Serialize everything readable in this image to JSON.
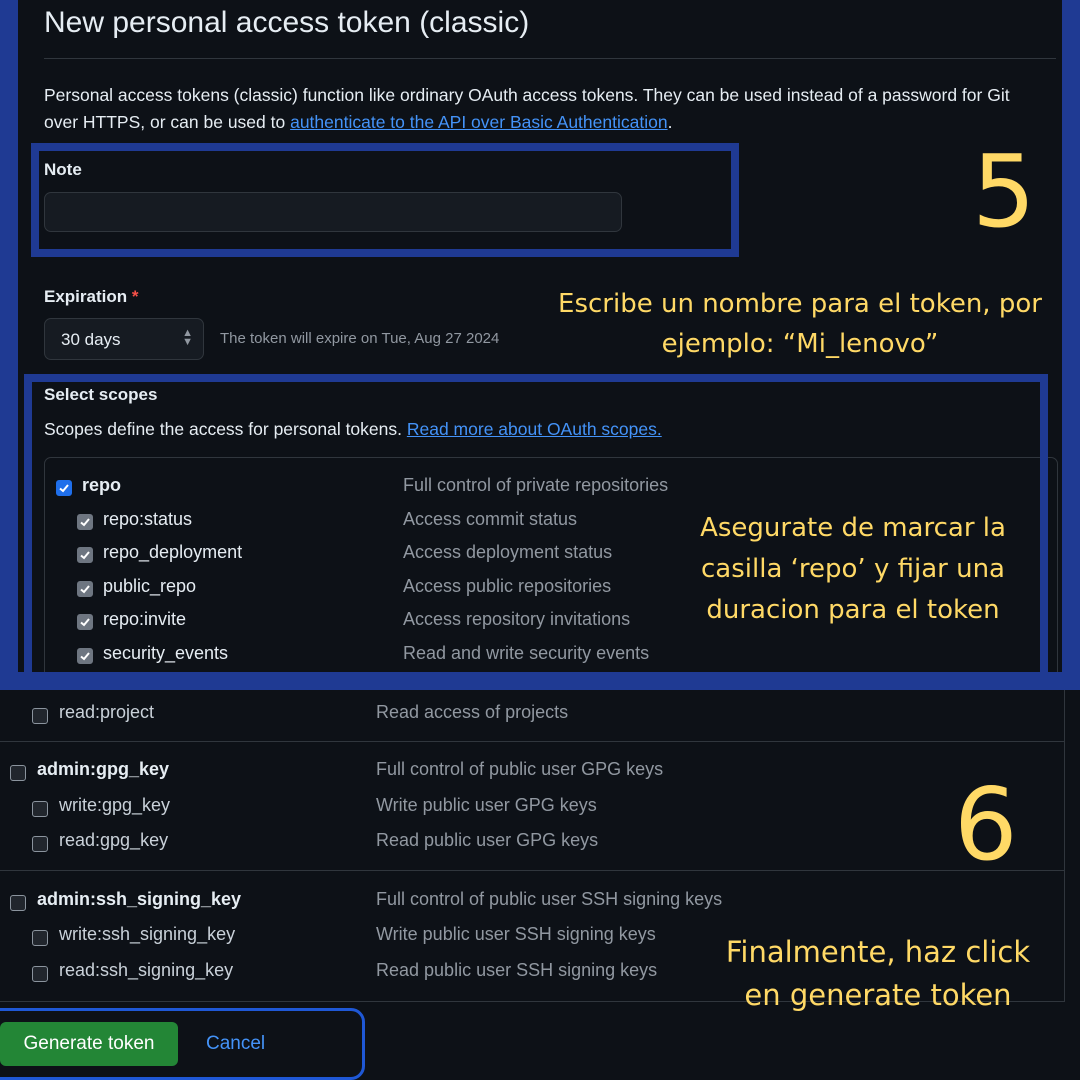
{
  "page": {
    "title": "New personal access token (classic)",
    "intro_text": "Personal access tokens (classic) function like ordinary OAuth access tokens. They can be used instead of a password for Git over HTTPS, or can be used to ",
    "intro_link": "authenticate to the API over Basic Authentication",
    "intro_end": "."
  },
  "note": {
    "label": "Note",
    "value": "",
    "placeholder": ""
  },
  "expiration": {
    "label": "Expiration",
    "required_mark": "*",
    "selected": "30 days",
    "helper": "The token will expire on Tue, Aug 27 2024"
  },
  "scopes": {
    "heading": "Select scopes",
    "description": "Scopes define the access for personal tokens. ",
    "link": "Read more about OAuth scopes.",
    "top_rows": [
      {
        "name": "repo",
        "desc": "Full control of private repositories",
        "checked": true,
        "parent": true
      },
      {
        "name": "repo:status",
        "desc": "Access commit status",
        "checked": true,
        "parent": false
      },
      {
        "name": "repo_deployment",
        "desc": "Access deployment status",
        "checked": true,
        "parent": false
      },
      {
        "name": "public_repo",
        "desc": "Access public repositories",
        "checked": true,
        "parent": false
      },
      {
        "name": "repo:invite",
        "desc": "Access repository invitations",
        "checked": true,
        "parent": false
      },
      {
        "name": "security_events",
        "desc": "Read and write security events",
        "checked": true,
        "parent": false
      }
    ],
    "bottom_rows": [
      {
        "name": "read:project",
        "desc": "Read access of projects",
        "checked": false,
        "parent": false
      },
      {
        "name": "admin:gpg_key",
        "desc": "Full control of public user GPG keys",
        "checked": false,
        "parent": true
      },
      {
        "name": "write:gpg_key",
        "desc": "Write public user GPG keys",
        "checked": false,
        "parent": false
      },
      {
        "name": "read:gpg_key",
        "desc": "Read public user GPG keys",
        "checked": false,
        "parent": false
      },
      {
        "name": "admin:ssh_signing_key",
        "desc": "Full control of public user SSH signing keys",
        "checked": false,
        "parent": true
      },
      {
        "name": "write:ssh_signing_key",
        "desc": "Write public user SSH signing keys",
        "checked": false,
        "parent": false
      },
      {
        "name": "read:ssh_signing_key",
        "desc": "Read public user SSH signing keys",
        "checked": false,
        "parent": false
      }
    ]
  },
  "actions": {
    "generate_label": "Generate token",
    "cancel_label": "Cancel"
  },
  "annotations": {
    "step5_number": "5",
    "step5_line1": "Escribe un nombre para el token, por",
    "step5_line2": "ejemplo: “Mi_lenovo”",
    "scopes_line1": "Asegurate de marcar la",
    "scopes_line2": "casilla ‘repo’ y fijar una",
    "scopes_line3": "duracion para el token",
    "step6_number": "6",
    "step6_line1": "Finalmente, haz click",
    "step6_line2": "en generate token"
  },
  "colors": {
    "background": "#0d1117",
    "frame_blue": "#1f3a93",
    "annotation_yellow": "#ffd966",
    "link_blue": "#4493f8",
    "primary_green": "#238636",
    "checkbox_blue": "#1f6feb"
  }
}
